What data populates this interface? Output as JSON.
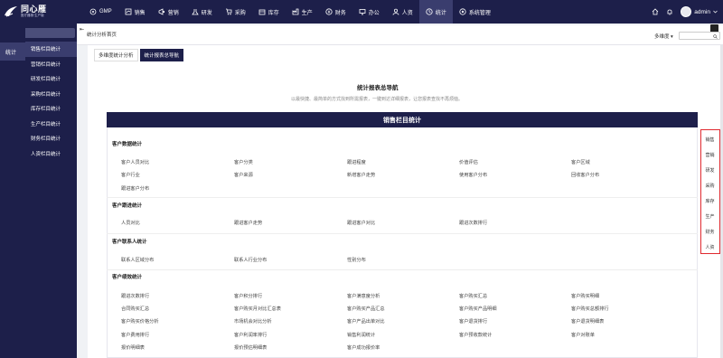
{
  "topbar": {
    "logo_name": "同心雁",
    "logo_sub": "医疗器械·生产版",
    "nav": [
      {
        "label": "GMP",
        "icon": "gmp-icon"
      },
      {
        "label": "销售",
        "icon": "sales-icon"
      },
      {
        "label": "营销",
        "icon": "marketing-icon"
      },
      {
        "label": "研发",
        "icon": "rd-icon"
      },
      {
        "label": "采购",
        "icon": "purchase-icon"
      },
      {
        "label": "库存",
        "icon": "inventory-icon"
      },
      {
        "label": "生产",
        "icon": "production-icon"
      },
      {
        "label": "财务",
        "icon": "finance-icon"
      },
      {
        "label": "办公",
        "icon": "office-icon"
      },
      {
        "label": "人资",
        "icon": "hr-icon"
      },
      {
        "label": "统计",
        "icon": "stats-icon"
      },
      {
        "label": "系统管理",
        "icon": "system-icon"
      }
    ],
    "user": "admin"
  },
  "sidebar": {
    "search_placeholder": "搜索",
    "module": "统计",
    "items": [
      "销售栏目统计",
      "营销栏目统计",
      "研发栏目统计",
      "采购栏目统计",
      "库存栏目统计",
      "生产栏目统计",
      "财务栏目统计",
      "人资栏目统计"
    ]
  },
  "breadcrumb": "统计分析首页",
  "dropdown": "多维度",
  "tabs": [
    "多维度统计分析",
    "统计报表总导航"
  ],
  "page_title": "统计报表总导航",
  "page_subtitle": "以最快捷、最简单的方式找到所需报表，一键到达详细报表，让您报表查找不再烦恼。",
  "panel_title": "销售栏目统计",
  "sections": {
    "s1": {
      "title": "客户数据统计",
      "items": [
        "客户人员对比",
        "客户分类",
        "跟进程度",
        "价值评估",
        "客户区域",
        "客户行业",
        "客户来源",
        "新增客户走势",
        "使用客户分布",
        "回收客户分布",
        "跟进客户分布"
      ]
    },
    "s2": {
      "title": "客户跟进统计",
      "items": [
        "人员对比",
        "跟进客户走势",
        "跟进客户对比",
        "跟进次数排行"
      ]
    },
    "s3": {
      "title": "客户联系人统计",
      "items": [
        "联系人区域分布",
        "联系人行业分布",
        "性别分布"
      ]
    },
    "s4": {
      "title": "客户绩效统计",
      "items": [
        "跟进次数排行",
        "客户积分排行",
        "客户满意度分析",
        "客户购买汇总",
        "客户购买明细",
        "合同购买汇总",
        "客户购买月对比汇总表",
        "客户购买产品汇总",
        "客户购买产品明细",
        "客户购买总额排行",
        "客户购买价格分析",
        "市场机会对比分析",
        "客户产品出单对比",
        "客户退货排行",
        "客户退货明细表",
        "客户费用排行",
        "客户利润率排行",
        "销售利润统计",
        "客户预收款统计",
        "客户对账单",
        "报价明细表",
        "报价预估明细表",
        "客户成功报价率"
      ]
    }
  },
  "right_nav": [
    "销售",
    "营销",
    "研发",
    "采购",
    "库存",
    "生产",
    "财务",
    "人资"
  ],
  "colors": {
    "nav_bg": "#1d1f4a",
    "active_bg": "#3a3d6e",
    "highlight": "#e0292f"
  }
}
